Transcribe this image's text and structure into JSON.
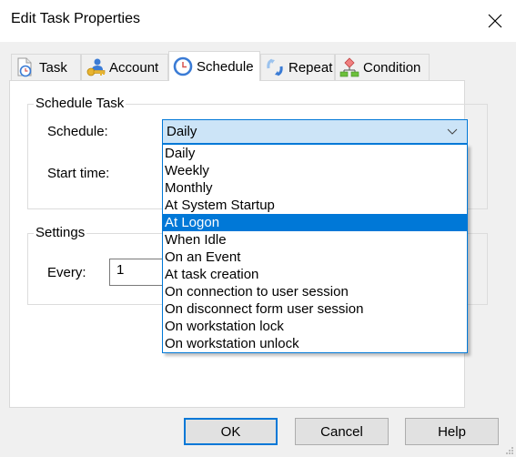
{
  "window": {
    "title": "Edit Task Properties",
    "close_icon": "close-icon"
  },
  "tabs": [
    {
      "label": "Task",
      "icon": "task-document-clock-icon",
      "active": false
    },
    {
      "label": "Account",
      "icon": "account-user-key-icon",
      "active": false
    },
    {
      "label": "Schedule",
      "icon": "clock-icon",
      "active": true
    },
    {
      "label": "Repeat",
      "icon": "repeat-arrows-icon",
      "active": false
    },
    {
      "label": "Condition",
      "icon": "condition-flowchart-icon",
      "active": false
    }
  ],
  "schedule_group": {
    "title": "Schedule Task",
    "schedule_label": "Schedule:",
    "schedule_value": "Daily",
    "start_time_label": "Start time:",
    "options": [
      "Daily",
      "Weekly",
      "Monthly",
      "At System Startup",
      "At Logon",
      "When Idle",
      "On an Event",
      "At task creation",
      "On connection to user session",
      "On disconnect form user session",
      "On workstation lock",
      "On workstation unlock"
    ],
    "highlighted_option": "At Logon"
  },
  "settings_group": {
    "title": "Settings",
    "every_label": "Every:",
    "every_value": "1"
  },
  "buttons": {
    "ok": "OK",
    "cancel": "Cancel",
    "help": "Help"
  },
  "colors": {
    "accent": "#0078d7",
    "combo_bg": "#cce4f7",
    "dialog_bg": "#f0f0f0"
  }
}
